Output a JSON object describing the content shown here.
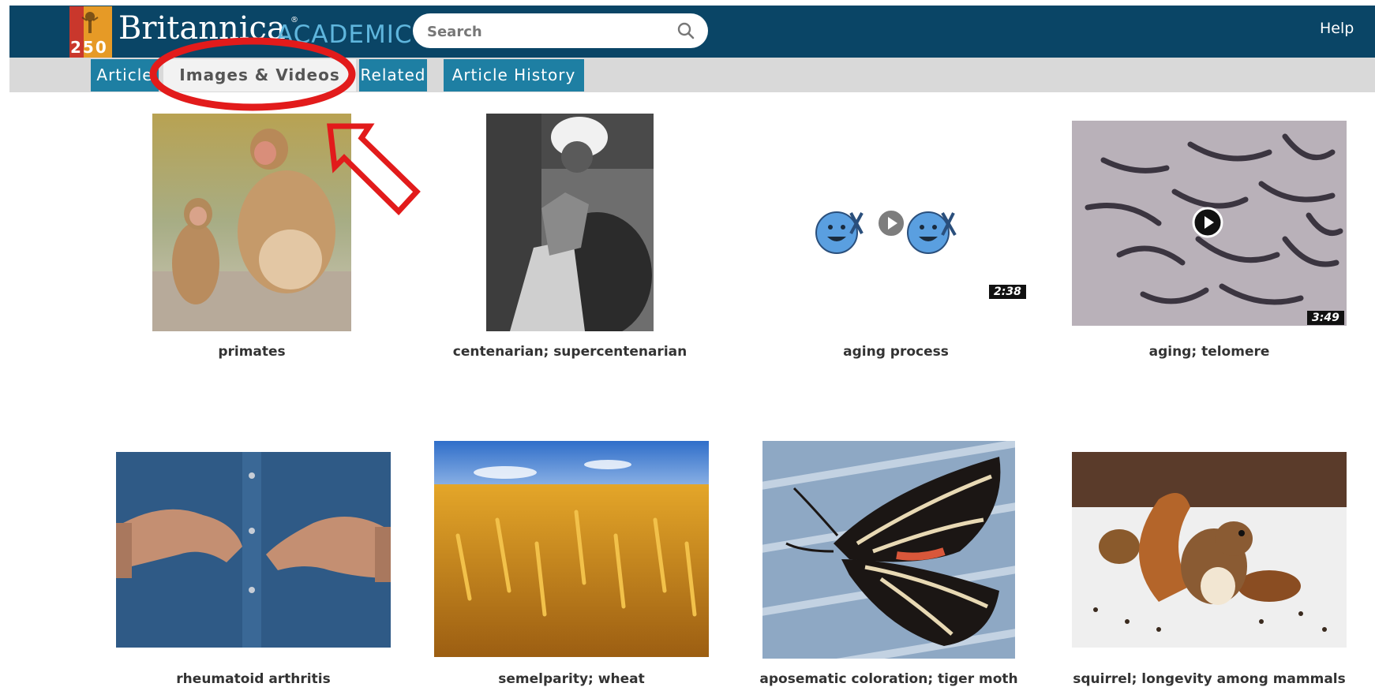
{
  "header": {
    "logo_badge": "250",
    "brand_name": "Britannica",
    "brand_suffix": "ACADEMIC",
    "brand_reg": "®",
    "search_placeholder": "Search",
    "help_label": "Help"
  },
  "tabs": [
    {
      "label": "Article",
      "active": false
    },
    {
      "label": "Images & Videos",
      "active": true
    },
    {
      "label": "Related",
      "active": false
    },
    {
      "label": "Article History",
      "active": false
    }
  ],
  "gallery": [
    {
      "caption": "primates",
      "type": "image"
    },
    {
      "caption": "centenarian; supercentenarian",
      "type": "image"
    },
    {
      "caption": "aging process",
      "type": "video",
      "duration": "2:38"
    },
    {
      "caption": "aging; telomere",
      "type": "video",
      "duration": "3:49"
    },
    {
      "caption": "rheumatoid arthritis",
      "type": "image"
    },
    {
      "caption": "semelparity; wheat",
      "type": "image"
    },
    {
      "caption": "aposematic coloration; tiger moth",
      "type": "image"
    },
    {
      "caption": "squirrel; longevity among mammals",
      "type": "image"
    }
  ],
  "colors": {
    "header_bg": "#0a4566",
    "tab_bg": "#1e7fa3",
    "tab_active_bg": "#f2f2f2",
    "annotation_red": "#e21b1b"
  },
  "icons": {
    "search": "search-icon",
    "play": "play-icon"
  }
}
